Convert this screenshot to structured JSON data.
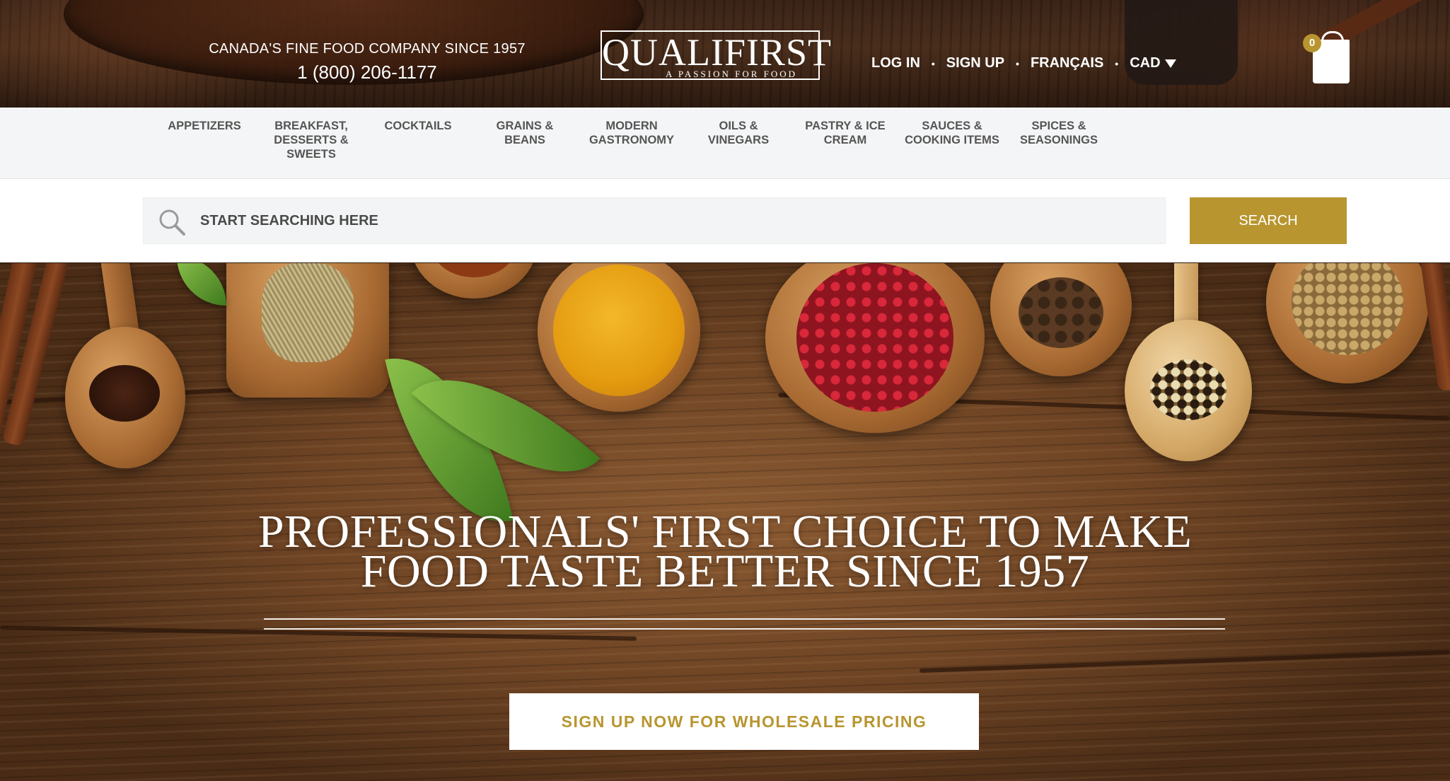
{
  "header": {
    "tagline": "CANADA'S FINE FOOD COMPANY SINCE 1957",
    "phone": "1 (800) 206-1177",
    "logo_name": "QUALIFIRST",
    "logo_tagline": "A PASSION FOR FOOD",
    "nav": {
      "login": "LOG IN",
      "signup": "SIGN UP",
      "language": "FRANÇAIS",
      "currency": "CAD"
    },
    "cart_count": "0"
  },
  "categories": [
    "APPETIZERS",
    "BREAKFAST, DESSERTS & SWEETS",
    "COCKTAILS",
    "GRAINS & BEANS",
    "MODERN GASTRONOMY",
    "OILS & VINEGARS",
    "PASTRY & ICE CREAM",
    "SAUCES & COOKING ITEMS",
    "SPICES & SEASONINGS"
  ],
  "search": {
    "placeholder": "START SEARCHING HERE",
    "button": "SEARCH"
  },
  "hero": {
    "title_line1": "PROFESSIONALS' FIRST CHOICE TO MAKE",
    "title_line2": "FOOD TASTE BETTER SINCE 1957",
    "cta": "SIGN UP NOW FOR WHOLESALE PRICING"
  },
  "colors": {
    "accent_gold": "#b8952f",
    "nav_bg": "#f4f5f6",
    "nav_text": "#555555"
  }
}
